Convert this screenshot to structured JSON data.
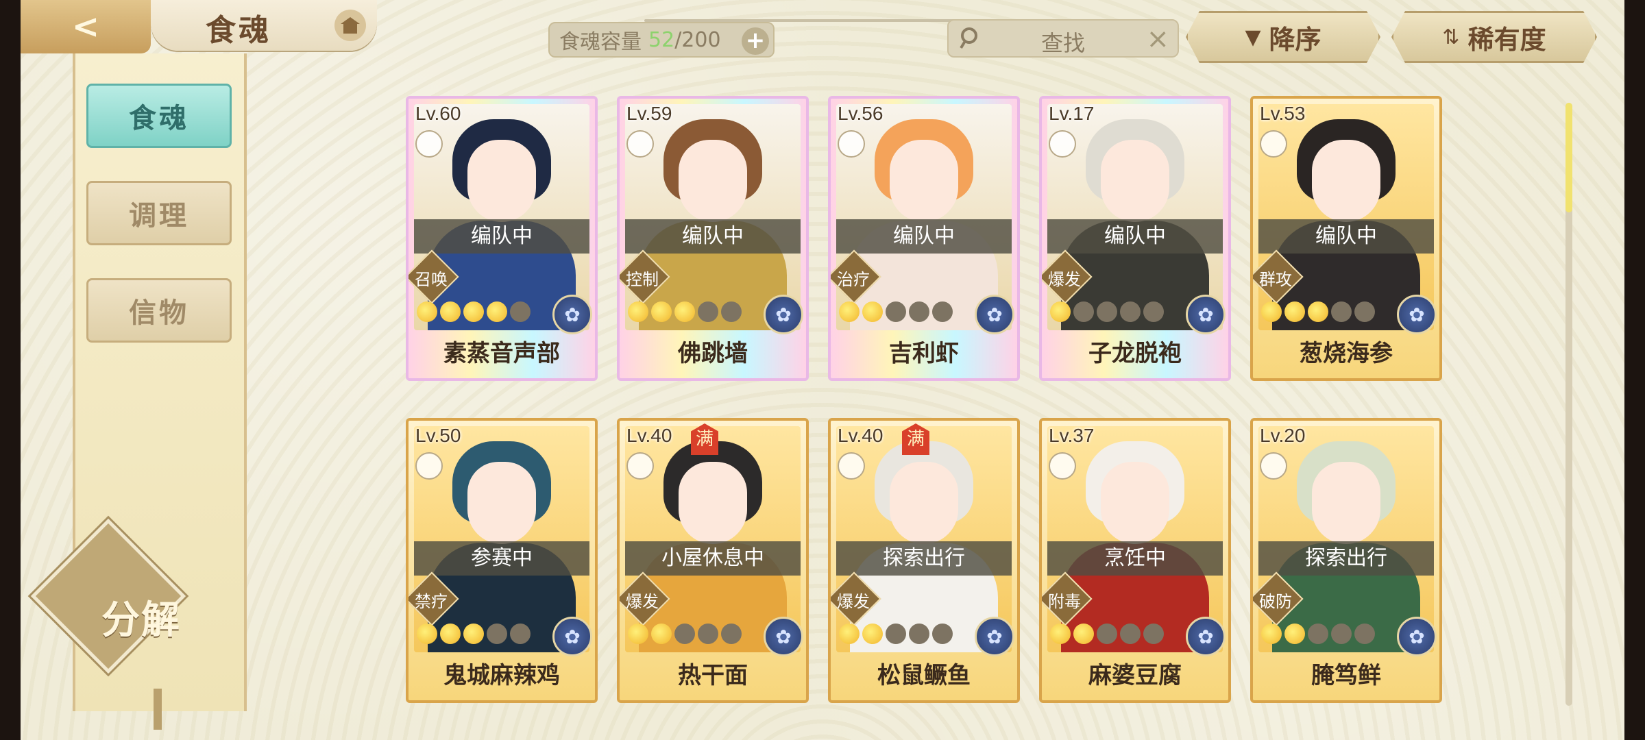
{
  "topbar": {
    "back_label": "<",
    "title": "食魂",
    "capacity_label": "食魂容量",
    "capacity_current": "52",
    "capacity_max": "/200",
    "capacity_plus": "+",
    "search_label": "查找",
    "search_clear": "×",
    "sort_order_label": "降序",
    "sort_order_icon": "▼",
    "sort_key_label": "稀有度",
    "sort_key_icon": "⇅"
  },
  "sidebar": {
    "items": [
      {
        "label": "食魂"
      },
      {
        "label": "调理"
      },
      {
        "label": "信物"
      }
    ],
    "decompose_label": "分解"
  },
  "cards": [
    {
      "level": "Lv.60",
      "status": "编队中",
      "role": "召唤",
      "stars_on": 4,
      "name": "素蒸音声部",
      "rarity": "rainbow",
      "max_badge": "",
      "hair": "#1f2a44",
      "body": "#2e4c8e"
    },
    {
      "level": "Lv.59",
      "status": "编队中",
      "role": "控制",
      "stars_on": 3,
      "name": "佛跳墙",
      "rarity": "rainbow",
      "max_badge": "",
      "hair": "#8b5a35",
      "body": "#c9a64a"
    },
    {
      "level": "Lv.56",
      "status": "编队中",
      "role": "治疗",
      "stars_on": 2,
      "name": "吉利虾",
      "rarity": "rainbow",
      "max_badge": "",
      "hair": "#f4a35a",
      "body": "#f3e4da"
    },
    {
      "level": "Lv.17",
      "status": "编队中",
      "role": "爆发",
      "stars_on": 1,
      "name": "子龙脱袍",
      "rarity": "rainbow",
      "max_badge": "",
      "hair": "#dfdcd2",
      "body": "#3a3a34"
    },
    {
      "level": "Lv.53",
      "status": "编队中",
      "role": "群攻",
      "stars_on": 3,
      "name": "葱烧海参",
      "rarity": "gold",
      "max_badge": "",
      "hair": "#2a2523",
      "body": "#2f2b2b"
    },
    {
      "level": "Lv.50",
      "status": "参赛中",
      "role": "禁疗",
      "stars_on": 3,
      "name": "鬼城麻辣鸡",
      "rarity": "gold",
      "max_badge": "",
      "hair": "#2d5b70",
      "body": "#1d2f3f"
    },
    {
      "level": "Lv.40",
      "status": "小屋休息中",
      "role": "爆发",
      "stars_on": 2,
      "name": "热干面",
      "rarity": "gold",
      "max_badge": "满",
      "hair": "#2c2a2a",
      "body": "#e6a63d"
    },
    {
      "level": "Lv.40",
      "status": "探索出行",
      "role": "爆发",
      "stars_on": 2,
      "name": "松鼠鳜鱼",
      "rarity": "gold",
      "max_badge": "满",
      "hair": "#e9e6df",
      "body": "#f3f1ec"
    },
    {
      "level": "Lv.37",
      "status": "烹饪中",
      "role": "附毒",
      "stars_on": 2,
      "name": "麻婆豆腐",
      "rarity": "gold",
      "max_badge": "",
      "hair": "#f3efe9",
      "body": "#b32b22"
    },
    {
      "level": "Lv.20",
      "status": "探索出行",
      "role": "破防",
      "stars_on": 2,
      "name": "腌笃鲜",
      "rarity": "gold",
      "max_badge": "",
      "hair": "#d8e0c8",
      "body": "#3b6b47"
    }
  ],
  "colors": {
    "accent_teal": "#7fd2c6",
    "gold_border": "#d9a44a",
    "capacity_green": "#8dd26d"
  }
}
